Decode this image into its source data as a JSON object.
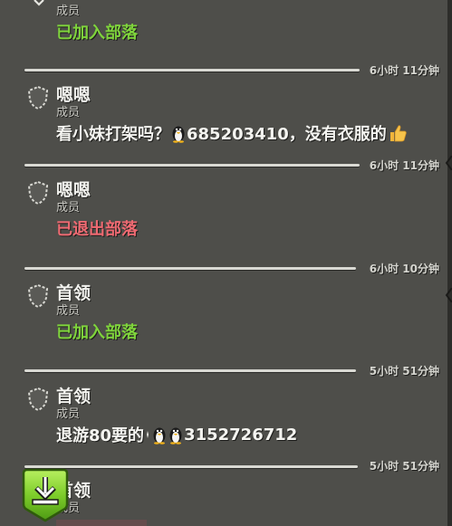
{
  "colors": {
    "background": "#4e4e4a",
    "divider": "#d9d9d3",
    "joined_green": "#7fd43c",
    "left_red": "#ef6a72",
    "download_green": "#7dcc2a"
  },
  "messages": [
    {
      "name": "",
      "role": "成员",
      "text": "已加入部落",
      "type": "joined",
      "timestamp_before": ""
    },
    {
      "name": "嗯嗯",
      "role": "成员",
      "text_parts": [
        "看小妹打架吗？",
        "685203410，没有衣服的"
      ],
      "type": "chat",
      "timestamp_before": "6小时 11分钟"
    },
    {
      "name": "嗯嗯",
      "role": "成员",
      "text": "已退出部落",
      "type": "left",
      "timestamp_before": "6小时 11分钟"
    },
    {
      "name": "首领",
      "role": "成员",
      "text": "已加入部落",
      "type": "joined",
      "timestamp_before": "6小时 10分钟"
    },
    {
      "name": "首领",
      "role": "成员",
      "text_parts": [
        "退游80要的",
        "3152726712"
      ],
      "type": "chat",
      "timestamp_before": "5小时 51分钟"
    },
    {
      "name": "首领",
      "role": "成员",
      "text": "",
      "type": "partial",
      "timestamp_before": "5小时 51分钟"
    }
  ],
  "icons": {
    "shield": "clan-badge-icon",
    "qq": "penguin-icon",
    "thumbs_up": "thumbs-up-icon",
    "download": "download-icon"
  }
}
